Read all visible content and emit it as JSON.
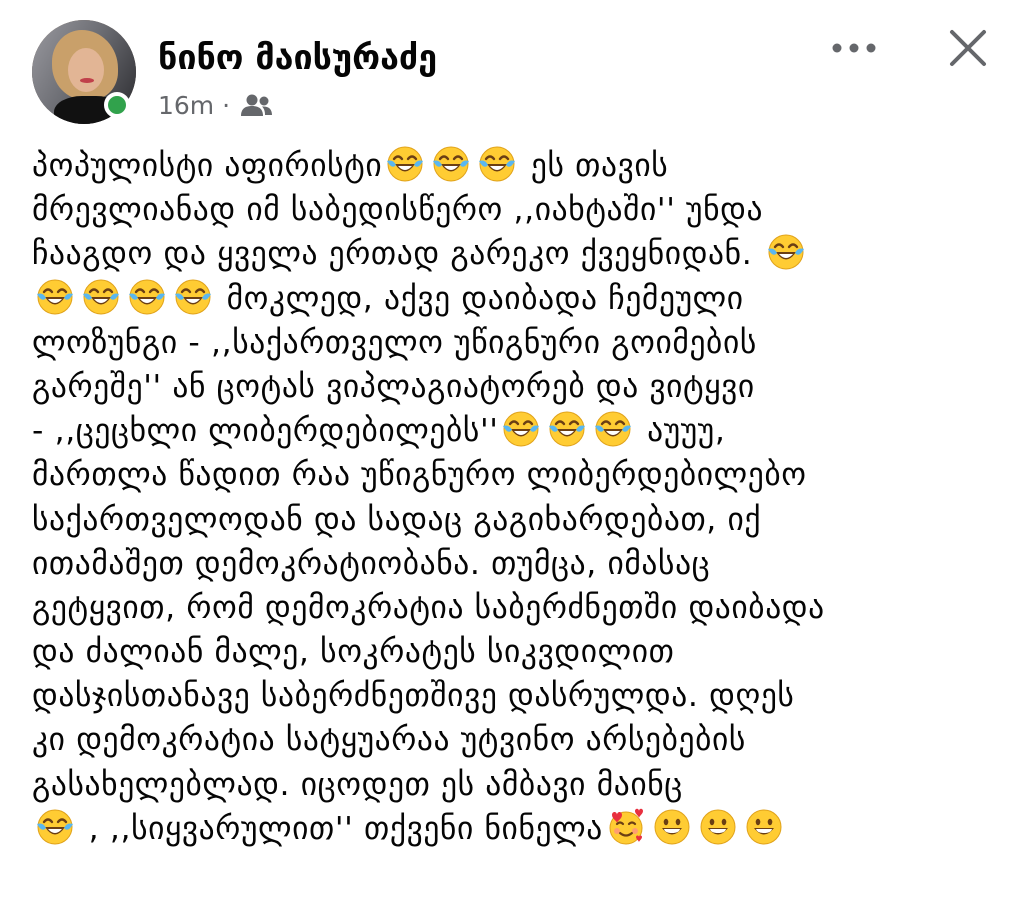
{
  "post": {
    "author": "ნინო მაისურაძე",
    "time": "16m",
    "separator": "·",
    "audience_icon": "friends-icon",
    "more_icon": "more-horizontal-icon",
    "close_icon": "close-icon",
    "online_color": "#31a24c",
    "text_lines": [
      [
        "პოპულისტი აფირისტი",
        "EMOJI:joy",
        "EMOJI:joy",
        "EMOJI:joy",
        " ეს თავის"
      ],
      [
        "მრევლიანად იმ საბედისწერო  ,,იახტაში'' უნდა"
      ],
      [
        "ჩააგდო და ყველა ერთად  გარეკო ქვეყნიდან. ",
        "EMOJI:joy"
      ],
      [
        "EMOJI:joy",
        "EMOJI:joy",
        "EMOJI:joy",
        "EMOJI:joy",
        " მოკლედ, აქვე დაიბადა ჩემეული"
      ],
      [
        "ლოზუნგი - ,,საქართველო უწიგნური გოიმების"
      ],
      [
        "გარეშე'' ან  ცოტას ვიპლაგიატორებ და ვიტყვი"
      ],
      [
        "- ,,ცეცხლი ლიბერდებილებს''",
        "EMOJI:joy",
        "EMOJI:joy",
        "EMOJI:joy",
        " აუუუ,"
      ],
      [
        "მართლა წადით რაა უწიგნურო ლიბერდებილებო"
      ],
      [
        "საქართველოდან და სადაც გაგიხარდებათ, იქ"
      ],
      [
        "ითამაშეთ დემოკრატიობანა. თუმცა, იმასაც"
      ],
      [
        "გეტყვით, რომ დემოკრატია საბერძნეთში დაიბადა"
      ],
      [
        "და ძალიან მალე, სოკრატეს სიკვდილით"
      ],
      [
        "დასჯისთანავე საბერძნეთშივე დასრულდა. დღეს"
      ],
      [
        "კი დემოკრატია სატყუარაა უტვინო არსებების"
      ],
      [
        "გასახელებლად. იცოდეთ ეს ამბავი  მაინც"
      ],
      [
        "EMOJI:joy",
        " ,  ,,სიყვარულით'' თქვენი ნინელა",
        "EMOJI:hearts",
        "EMOJI:grin",
        "EMOJI:grin",
        "EMOJI:grin"
      ]
    ]
  }
}
